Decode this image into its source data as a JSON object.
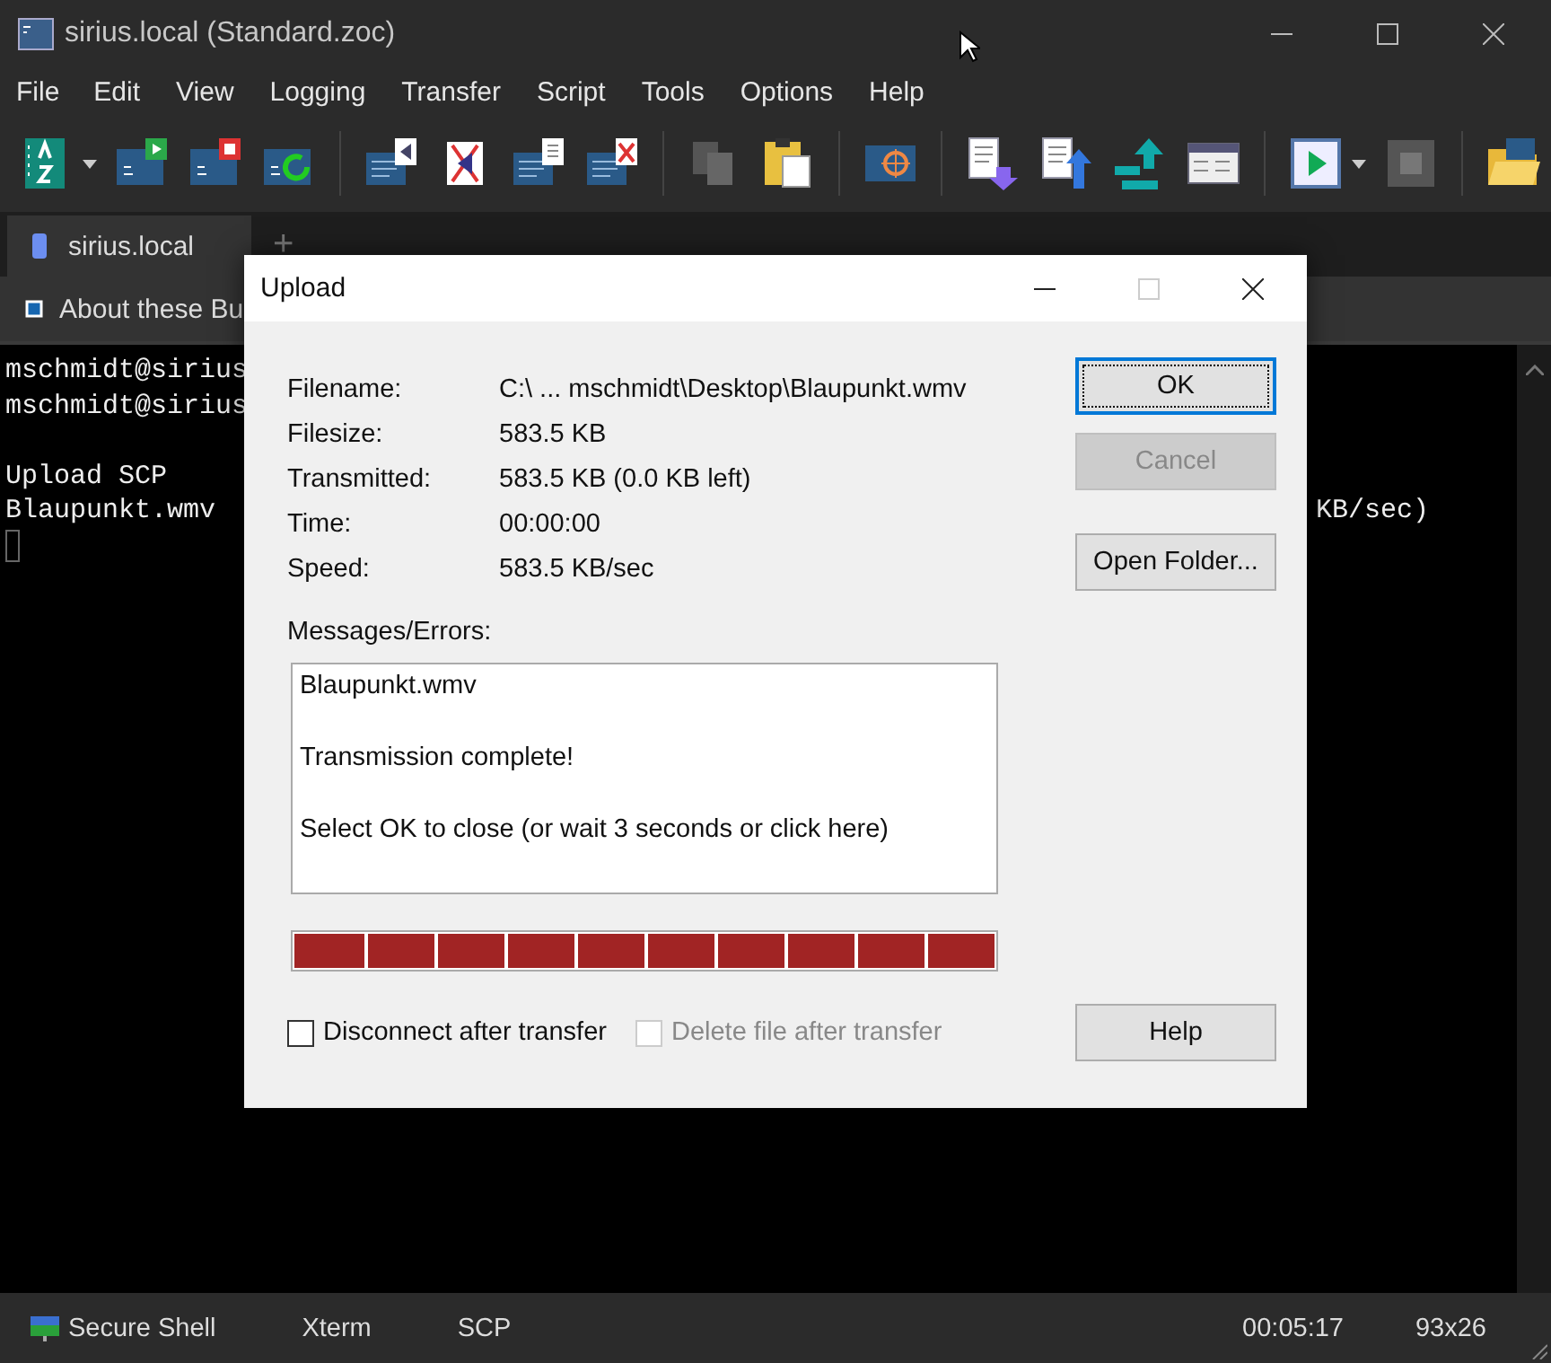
{
  "window": {
    "title": "sirius.local (Standard.zoc)"
  },
  "menu": [
    "File",
    "Edit",
    "View",
    "Logging",
    "Transfer",
    "Script",
    "Tools",
    "Options",
    "Help"
  ],
  "tabs": [
    {
      "label": "sirius.local",
      "selected": true
    }
  ],
  "new_tab": "+",
  "button_bar": [
    {
      "label": "About these Bu"
    }
  ],
  "terminal": {
    "blocks": [
      [
        {
          "text": "mschmidt@sirius"
        },
        {
          "text": "mschmidt@sirius"
        }
      ],
      [
        {
          "text": "Upload SCP"
        },
        {
          "text": "Blaupunkt.wmv",
          "tail": "KB/sec)"
        }
      ]
    ]
  },
  "dialog": {
    "title": "Upload",
    "fields": [
      {
        "label": "Filename:",
        "value": "C:\\ ... mschmidt\\Desktop\\Blaupunkt.wmv"
      },
      {
        "label": "Filesize:",
        "value": "583.5 KB"
      },
      {
        "label": "Transmitted:",
        "value": "583.5 KB (0.0 KB left)"
      },
      {
        "label": "Time:",
        "value": "00:00:00"
      },
      {
        "label": "Speed:",
        "value": "583.5 KB/sec"
      }
    ],
    "messages_label": "Messages/Errors:",
    "messages": [
      "Blaupunkt.wmv",
      "Transmission complete!",
      "Select OK to close (or wait 3 seconds or click here)"
    ],
    "progress": {
      "level": 1
    },
    "checkboxes": [
      {
        "label": "Disconnect after transfer",
        "checked": false,
        "disabled": false
      },
      {
        "label": "Delete file after transfer",
        "checked": false,
        "disabled": true
      }
    ],
    "buttons": [
      {
        "label": "OK",
        "default": true,
        "disabled": false
      },
      {
        "label": "Cancel",
        "default": false,
        "disabled": true
      },
      {
        "label": "Open Folder...",
        "default": false,
        "disabled": false
      }
    ],
    "help_button": "Help"
  },
  "status_bar": {
    "left": [
      "Secure Shell",
      "Xterm",
      "SCP"
    ],
    "right": [
      "00:05:17",
      "93x26"
    ]
  }
}
